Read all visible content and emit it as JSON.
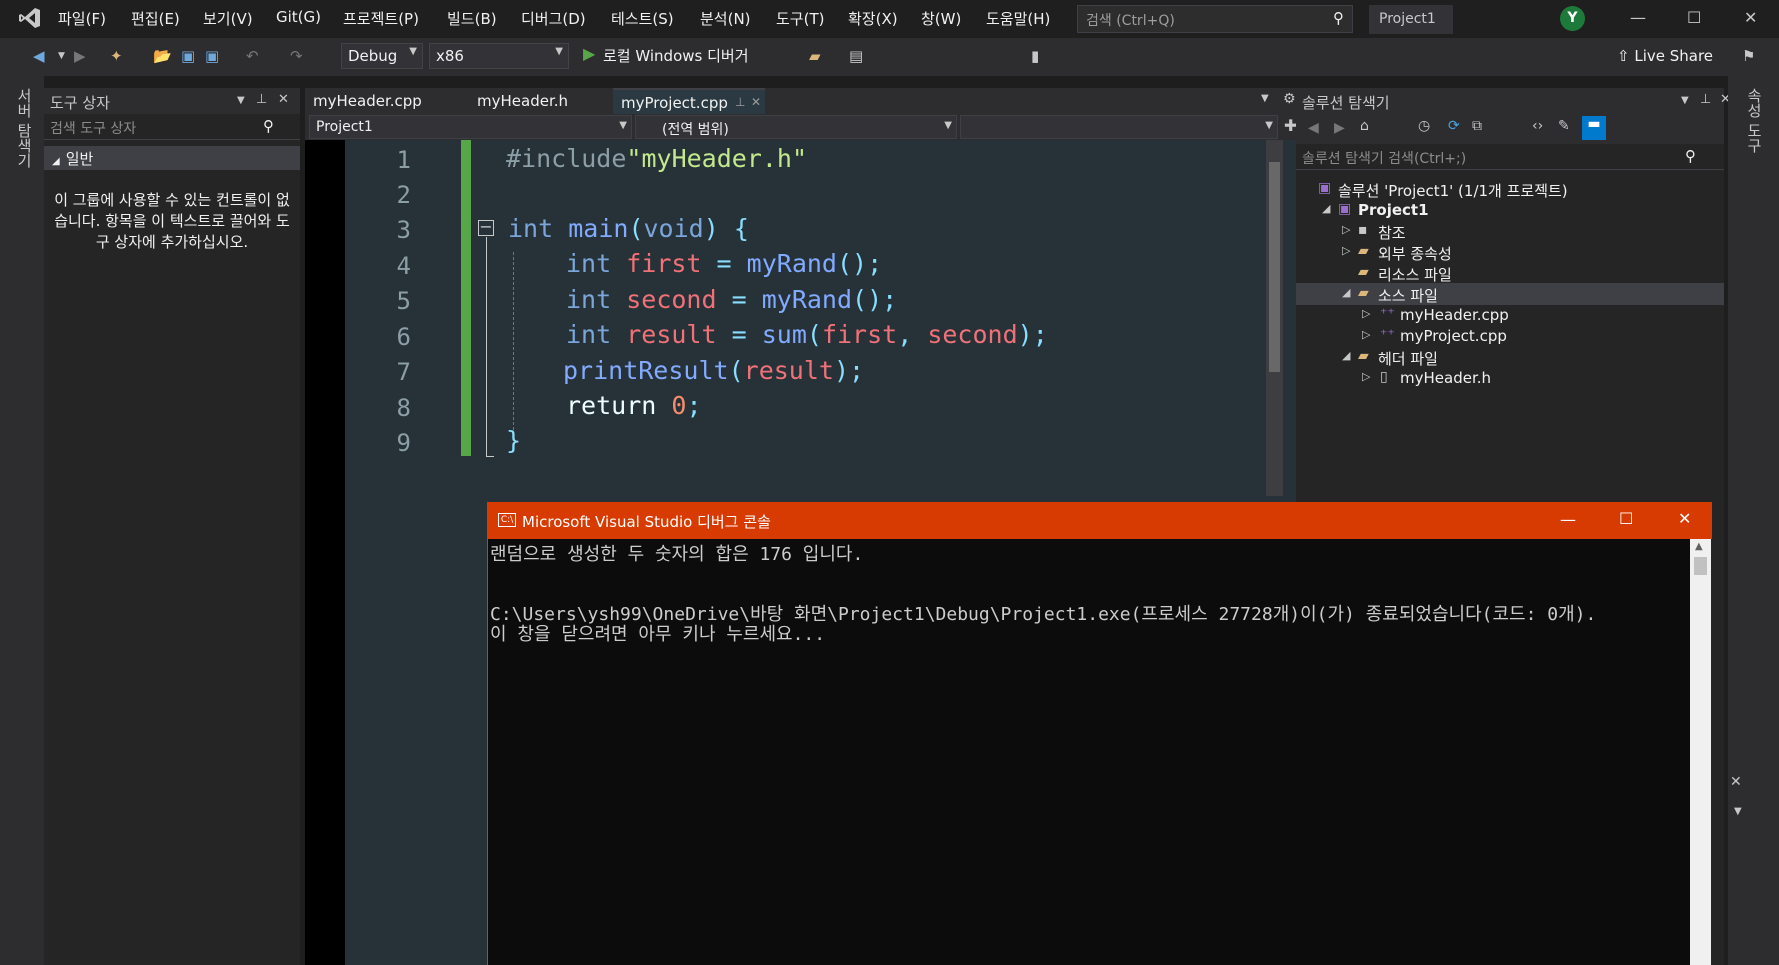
{
  "menu": [
    "파일(F)",
    "편집(E)",
    "보기(V)",
    "Git(G)",
    "프로젝트(P)",
    "빌드(B)",
    "디버그(D)",
    "테스트(S)",
    "분석(N)",
    "도구(T)",
    "확장(X)",
    "창(W)",
    "도움말(H)"
  ],
  "search": {
    "placeholder": "검색 (Ctrl+Q)"
  },
  "project_badge": "Project1",
  "user_initial": "Y",
  "toolbar": {
    "config": "Debug",
    "platform": "x86",
    "run_label": "로컬 Windows 디버거",
    "live_share": "Live Share"
  },
  "left_strip": {
    "server_explorer": "서버 탐색기"
  },
  "toolbox": {
    "title": "도구 상자",
    "search_placeholder": "검색 도구 상자",
    "group": "일반",
    "empty_message": "이 그룹에 사용할 수 있는 컨트롤이 없습니다. 항목을 이 텍스트로 끌어와 도구 상자에 추가하십시오."
  },
  "tabs": [
    {
      "label": "myHeader.cpp"
    },
    {
      "label": "myHeader.h"
    },
    {
      "label": "myProject.cpp"
    }
  ],
  "navbar": {
    "project": "Project1",
    "scope": "(전역 범위)"
  },
  "editor": {
    "line_numbers": [
      "1",
      "2",
      "3",
      "4",
      "5",
      "6",
      "7",
      "8",
      "9"
    ],
    "lines": [
      "#include\"myHeader.h\"",
      "",
      "int main(void) {",
      "    int first = myRand();",
      "    int second = myRand();",
      "    int result = sum(first, second);",
      "    printResult(result);",
      "    return 0;",
      "}"
    ]
  },
  "solution": {
    "title": "솔루션 탐색기",
    "search_placeholder": "솔루션 탐색기 검색(Ctrl+;)",
    "items": [
      {
        "label": "솔루션 'Project1' (1/1개 프로젝트)"
      },
      {
        "label": "Project1"
      },
      {
        "label": "참조"
      },
      {
        "label": "외부 종속성"
      },
      {
        "label": "리소스 파일"
      },
      {
        "label": "소스 파일"
      },
      {
        "label": "myHeader.cpp"
      },
      {
        "label": "myProject.cpp"
      },
      {
        "label": "헤더 파일"
      },
      {
        "label": "myHeader.h"
      }
    ]
  },
  "right_strip": {
    "properties": "속성 도구"
  },
  "console": {
    "title": "Microsoft Visual Studio 디버그 콘솔",
    "lines": [
      "랜덤으로 생성한 두 숫자의 합은 176 입니다.",
      "",
      "C:\\Users\\ysh99\\OneDrive\\바탕 화면\\Project1\\Debug\\Project1.exe(프로세스 27728개)이(가) 종료되었습니다(코드: 0개).",
      "이 창을 닫으려면 아무 키나 누르세요..."
    ]
  }
}
